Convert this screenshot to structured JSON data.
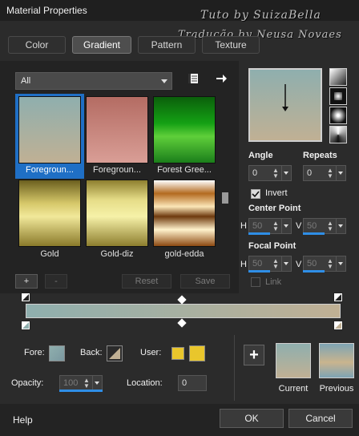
{
  "window": {
    "title": "Material Properties"
  },
  "watermark": {
    "line1": "Tuto by  SuizaBella",
    "line2": "Tradução by  Neusa Novaes"
  },
  "tabs": [
    {
      "label": "Color",
      "active": false
    },
    {
      "label": "Gradient",
      "active": true
    },
    {
      "label": "Pattern",
      "active": false
    },
    {
      "label": "Texture",
      "active": false
    }
  ],
  "library": {
    "filter_value": "All",
    "swatches": [
      {
        "label": "Foregroun...",
        "selected": true
      },
      {
        "label": "Foregroun...",
        "selected": false
      },
      {
        "label": "Forest Gree...",
        "selected": false
      },
      {
        "label": "Gold",
        "selected": false
      },
      {
        "label": "Gold-diz",
        "selected": false
      },
      {
        "label": "gold-edda",
        "selected": false
      }
    ],
    "buttons": {
      "add": "+",
      "remove": "-",
      "reset": "Reset",
      "save": "Save"
    }
  },
  "gradient_props": {
    "angle_label": "Angle",
    "angle_value": "0",
    "repeats_label": "Repeats",
    "repeats_value": "0",
    "invert_label": "Invert",
    "invert_checked": true,
    "center_point_label": "Center Point",
    "center_h_label": "H",
    "center_h_value": "50",
    "center_v_label": "V",
    "center_v_value": "50",
    "focal_point_label": "Focal Point",
    "focal_h_label": "H",
    "focal_h_value": "50",
    "focal_v_label": "V",
    "focal_v_value": "50",
    "link_label": "Link"
  },
  "bottom": {
    "fore_label": "Fore:",
    "back_label": "Back:",
    "user_label": "User:",
    "opacity_label": "Opacity:",
    "opacity_value": "100",
    "location_label": "Location:",
    "location_value": "0",
    "add_swatch": "+",
    "current_label": "Current",
    "previous_label": "Previous"
  },
  "footer": {
    "help": "Help",
    "ok": "OK",
    "cancel": "Cancel"
  },
  "colors": {
    "gradient_start": "#8fafae",
    "gradient_end": "#c0b094",
    "selection_blue": "#1f6fc5",
    "user_yellow": "#e9c62c"
  }
}
